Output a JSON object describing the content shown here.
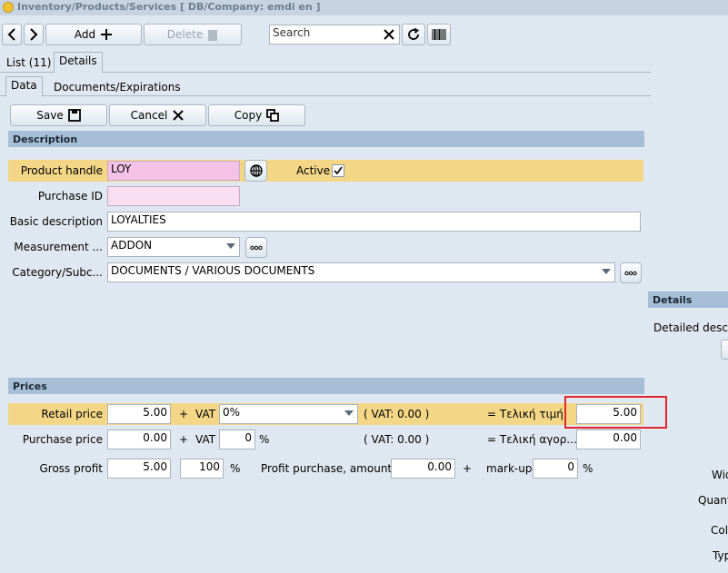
{
  "window": {
    "title": "Inventory/Products/Services   [ DB/Company: emdi en ]"
  },
  "toolbar": {
    "add_label": "Add",
    "delete_label": "Delete",
    "search_placeholder": "Search"
  },
  "tabs": {
    "list": "List (11)",
    "details": "Details"
  },
  "subtabs": {
    "data": "Data",
    "documents": "Documents/Expirations"
  },
  "actions": {
    "save": "Save",
    "cancel": "Cancel",
    "copy": "Copy"
  },
  "description": {
    "section_title": "Description",
    "product_handle_label": "Product handle",
    "product_handle_value": "LOY",
    "active_label": "Active",
    "active_checked": true,
    "purchase_id_label": "Purchase ID",
    "purchase_id_value": "",
    "basic_description_label": "Basic description",
    "basic_description_value": "LOYALTIES",
    "measurement_label": "Measurement ...",
    "measurement_value": "ADDON",
    "category_label": "Category/Subc...",
    "category_value": "DOCUMENTS / VARIOUS DOCUMENTS"
  },
  "prices": {
    "section_title": "Prices",
    "retail_label": "Retail price",
    "retail_value": "5.00",
    "plus": "+",
    "vat_label": "VAT",
    "retail_vat_value": "0%",
    "retail_vat_amount": "( VAT: 0.00 )",
    "final_price_label": "= Τελική τιμή",
    "final_price_value": "5.00",
    "purchase_label": "Purchase price",
    "purchase_value": "0.00",
    "purchase_vat_value": "0",
    "percent": "%",
    "purchase_vat_amount": "( VAT: 0.00 )",
    "final_purchase_label": "= Τελική αγορ...",
    "final_purchase_value": "0.00",
    "gross_profit_label": "Gross profit",
    "gross_profit_value": "5.00",
    "gross_profit_pct": "100",
    "profit_purchase_label": "Profit purchase, amount",
    "profit_purchase_value": "0.00",
    "markup_label": "mark-up",
    "markup_value": "0"
  },
  "details_panel": {
    "section_title": "Details",
    "detailed_desc_label": "Detailed desc.",
    "width_label": "Wid",
    "quantity_label": "Quant",
    "color_label": "Col",
    "type_label": "Typ"
  },
  "colors": {
    "highlight_border": "#e3262b",
    "section_bg": "#a6bfd7",
    "band_bg": "#f3d787",
    "pink_field": "#f3c2e6"
  }
}
